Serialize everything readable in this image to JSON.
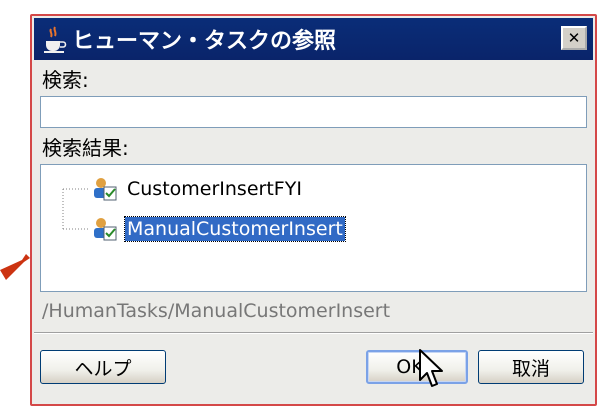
{
  "dialog": {
    "title": "ヒューマン・タスクの参照",
    "close_symbol": "✕",
    "search": {
      "label": "検索:",
      "value": "",
      "placeholder": ""
    },
    "results": {
      "label": "検索結果:",
      "items": [
        {
          "label": "CustomerInsertFYI",
          "icon": "human-task-icon",
          "selected": false
        },
        {
          "label": "ManualCustomerInsert",
          "icon": "human-task-icon",
          "selected": true
        }
      ]
    },
    "selected_path": "/HumanTasks/ManualCustomerInsert",
    "buttons": {
      "help": "ヘルプ",
      "ok": "OK",
      "cancel": "取消"
    }
  },
  "colors": {
    "title_bar": "#0a246a",
    "selection": "#316ac5",
    "highlight_border": "#d44848"
  }
}
